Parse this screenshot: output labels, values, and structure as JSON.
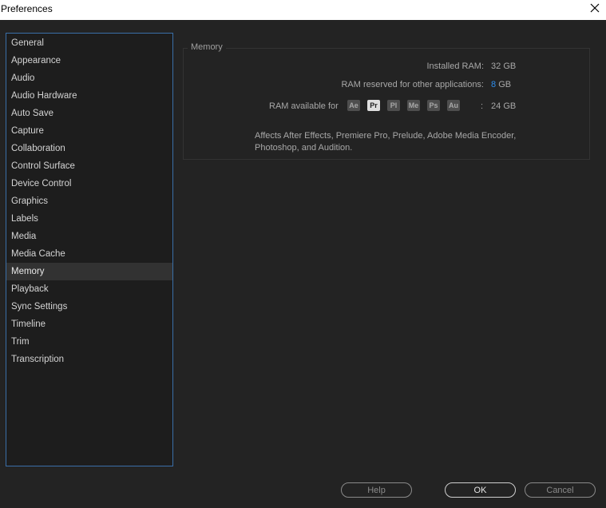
{
  "window": {
    "title": "Preferences"
  },
  "sidebar": {
    "items": [
      {
        "label": "General"
      },
      {
        "label": "Appearance"
      },
      {
        "label": "Audio"
      },
      {
        "label": "Audio Hardware"
      },
      {
        "label": "Auto Save"
      },
      {
        "label": "Capture"
      },
      {
        "label": "Collaboration"
      },
      {
        "label": "Control Surface"
      },
      {
        "label": "Device Control"
      },
      {
        "label": "Graphics"
      },
      {
        "label": "Labels"
      },
      {
        "label": "Media"
      },
      {
        "label": "Media Cache"
      },
      {
        "label": "Memory",
        "selected": true
      },
      {
        "label": "Playback"
      },
      {
        "label": "Sync Settings"
      },
      {
        "label": "Timeline"
      },
      {
        "label": "Trim"
      },
      {
        "label": "Transcription"
      }
    ]
  },
  "memory": {
    "group_title": "Memory",
    "installed_label": "Installed RAM:",
    "installed_value": "32",
    "installed_unit": "GB",
    "reserved_label": "RAM reserved for other applications:",
    "reserved_value": "8",
    "reserved_unit": "GB",
    "available_label": "RAM available for",
    "apps": [
      {
        "abbr": "Ae",
        "active": false
      },
      {
        "abbr": "Pr",
        "active": true
      },
      {
        "abbr": "Pl",
        "active": false
      },
      {
        "abbr": "Me",
        "active": false
      },
      {
        "abbr": "Ps",
        "active": false
      },
      {
        "abbr": "Au",
        "active": false
      }
    ],
    "available_sep": ":",
    "available_value": "24",
    "available_unit": "GB",
    "description_line1": "Affects After Effects, Premiere Pro, Prelude, Adobe Media Encoder,",
    "description_line2": "Photoshop, and Audition."
  },
  "buttons": {
    "help": "Help",
    "ok": "OK",
    "cancel": "Cancel"
  },
  "colors": {
    "accent": "#2d8ceb",
    "sidebar_border": "#3a6fa8",
    "background": "#232323"
  }
}
